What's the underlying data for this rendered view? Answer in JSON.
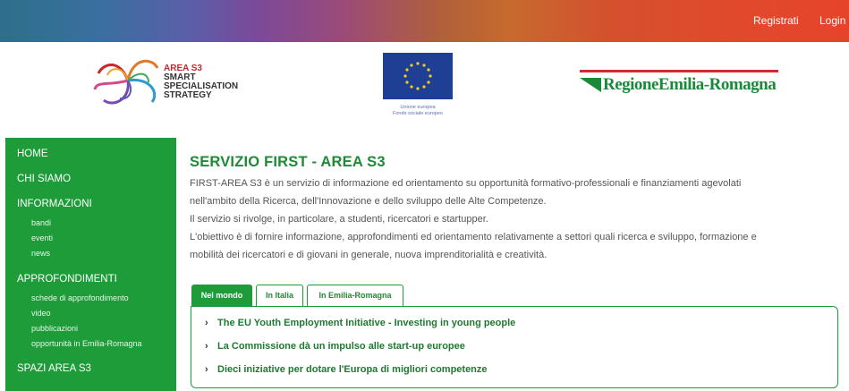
{
  "topbar": {
    "registrati": "Registrati",
    "login": "Login"
  },
  "header": {
    "area_logo": {
      "line1": "AREA S3",
      "line2": "SMART",
      "line3": "SPECIALISATION",
      "line4": "STRATEGY"
    },
    "eu_logo": {
      "caption1": "Unione europea",
      "caption2": "Fondo sociale europeo"
    },
    "region_logo": {
      "text": "RegioneEmilia-Romagna"
    }
  },
  "sidebar": {
    "items": [
      {
        "label": "HOME"
      },
      {
        "label": "CHI SIAMO"
      },
      {
        "label": "INFORMAZIONI"
      },
      {
        "label": "bandi"
      },
      {
        "label": "eventi"
      },
      {
        "label": "news"
      },
      {
        "label": "APPROFONDIMENTI"
      },
      {
        "label": "schede di approfondimento"
      },
      {
        "label": "video"
      },
      {
        "label": "pubblicazioni"
      },
      {
        "label": "opportunità in Emilia-Romagna"
      },
      {
        "label": "SPAZI AREA S3"
      }
    ]
  },
  "main": {
    "title": "SERVIZIO FIRST - AREA S3",
    "paragraphs": [
      "FIRST-AREA S3 è un servizio di informazione ed orientamento su opportunità formativo-professionali e finanziamenti agevolati",
      "nell'ambito della Ricerca, dell'Innovazione e dello sviluppo delle Alte Competenze.",
      "Il servizio si rivolge, in particolare, a studenti, ricercatori e startupper.",
      "L'obiettivo è di fornire informazione, approfondimenti ed orientamento relativamente a settori quali ricerca e sviluppo, formazione e",
      "mobilità dei ricercatori e di giovani in generale, nuova imprenditorialità e creatività."
    ],
    "tabs": [
      {
        "label": "Nel mondo"
      },
      {
        "label": "In Italia"
      },
      {
        "label": "In Emilia-Romagna"
      }
    ],
    "news": [
      {
        "title": "The EU Youth Employment Initiative - Investing in young people"
      },
      {
        "title": "La Commissione dà un impulso alle start-up europee"
      },
      {
        "title": "Dieci iniziative per dotare l'Europa di migliori competenze"
      }
    ]
  },
  "colors": {
    "brand_green": "#1e9c3a",
    "title_green": "#1e8a36",
    "region_red": "#d22b2b"
  },
  "icons": {
    "news_bullet": "chevron-right-icon"
  }
}
